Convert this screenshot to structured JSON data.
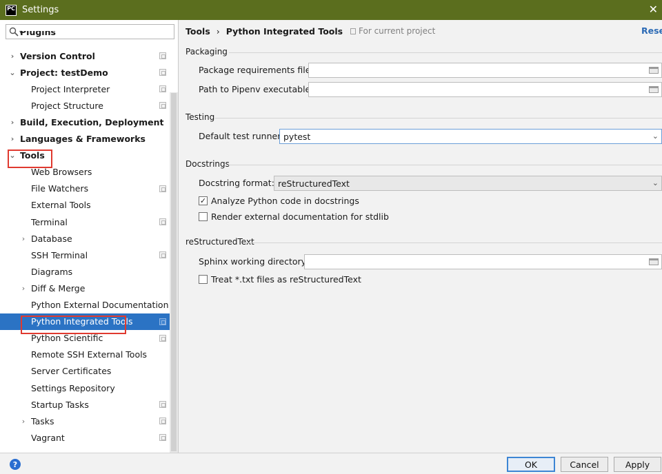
{
  "window": {
    "title": "Settings",
    "app_icon_text": "PC"
  },
  "search": {
    "placeholder": ""
  },
  "tree": [
    {
      "label": "Plugins",
      "level": 0,
      "arrow": "",
      "bold": true,
      "copy": false,
      "cut": true
    },
    {
      "label": "Version Control",
      "level": 0,
      "arrow": "›",
      "bold": true,
      "copy": true
    },
    {
      "label": "Project: testDemo",
      "level": 0,
      "arrow": "⌄",
      "bold": true,
      "copy": true
    },
    {
      "label": "Project Interpreter",
      "level": 1,
      "arrow": "",
      "bold": false,
      "copy": true
    },
    {
      "label": "Project Structure",
      "level": 1,
      "arrow": "",
      "bold": false,
      "copy": true
    },
    {
      "label": "Build, Execution, Deployment",
      "level": 0,
      "arrow": "›",
      "bold": true,
      "copy": false
    },
    {
      "label": "Languages & Frameworks",
      "level": 0,
      "arrow": "›",
      "bold": true,
      "copy": false
    },
    {
      "label": "Tools",
      "level": 0,
      "arrow": "⌄",
      "bold": true,
      "copy": false
    },
    {
      "label": "Web Browsers",
      "level": 1,
      "arrow": "",
      "bold": false,
      "copy": false
    },
    {
      "label": "File Watchers",
      "level": 1,
      "arrow": "",
      "bold": false,
      "copy": true
    },
    {
      "label": "External Tools",
      "level": 1,
      "arrow": "",
      "bold": false,
      "copy": false
    },
    {
      "label": "Terminal",
      "level": 1,
      "arrow": "",
      "bold": false,
      "copy": true
    },
    {
      "label": "Database",
      "level": 1,
      "arrow": "›",
      "bold": false,
      "copy": false
    },
    {
      "label": "SSH Terminal",
      "level": 1,
      "arrow": "",
      "bold": false,
      "copy": true
    },
    {
      "label": "Diagrams",
      "level": 1,
      "arrow": "",
      "bold": false,
      "copy": false
    },
    {
      "label": "Diff & Merge",
      "level": 1,
      "arrow": "›",
      "bold": false,
      "copy": false
    },
    {
      "label": "Python External Documentation",
      "level": 1,
      "arrow": "",
      "bold": false,
      "copy": false
    },
    {
      "label": "Python Integrated Tools",
      "level": 1,
      "arrow": "",
      "bold": false,
      "copy": true,
      "selected": true
    },
    {
      "label": "Python Scientific",
      "level": 1,
      "arrow": "",
      "bold": false,
      "copy": true
    },
    {
      "label": "Remote SSH External Tools",
      "level": 1,
      "arrow": "",
      "bold": false,
      "copy": false
    },
    {
      "label": "Server Certificates",
      "level": 1,
      "arrow": "",
      "bold": false,
      "copy": false
    },
    {
      "label": "Settings Repository",
      "level": 1,
      "arrow": "",
      "bold": false,
      "copy": false
    },
    {
      "label": "Startup Tasks",
      "level": 1,
      "arrow": "",
      "bold": false,
      "copy": true
    },
    {
      "label": "Tasks",
      "level": 1,
      "arrow": "›",
      "bold": false,
      "copy": true
    },
    {
      "label": "Vagrant",
      "level": 1,
      "arrow": "",
      "bold": false,
      "copy": true
    }
  ],
  "header": {
    "crumb_parent": "Tools",
    "crumb_sep": "›",
    "crumb_current": "Python Integrated Tools",
    "scope": "For current project",
    "reset": "Reset"
  },
  "packaging": {
    "title": "Packaging",
    "requirements_label": "Package requirements file:",
    "requirements_value": "",
    "pipenv_label": "Path to Pipenv executable:",
    "pipenv_value": ""
  },
  "testing": {
    "title": "Testing",
    "runner_label": "Default test runner:",
    "runner_value": "pytest"
  },
  "docstrings": {
    "title": "Docstrings",
    "format_label": "Docstring format:",
    "format_value": "reStructuredText",
    "analyze_label": "Analyze Python code in docstrings",
    "analyze_checked": true,
    "render_label": "Render external documentation for stdlib",
    "render_checked": false
  },
  "rst": {
    "title": "reStructuredText",
    "sphinx_label": "Sphinx working directory:",
    "sphinx_value": "",
    "treat_label": "Treat *.txt files as reStructuredText",
    "treat_checked": false
  },
  "buttons": {
    "help": "?",
    "ok": "OK",
    "cancel": "Cancel",
    "apply": "Apply"
  }
}
